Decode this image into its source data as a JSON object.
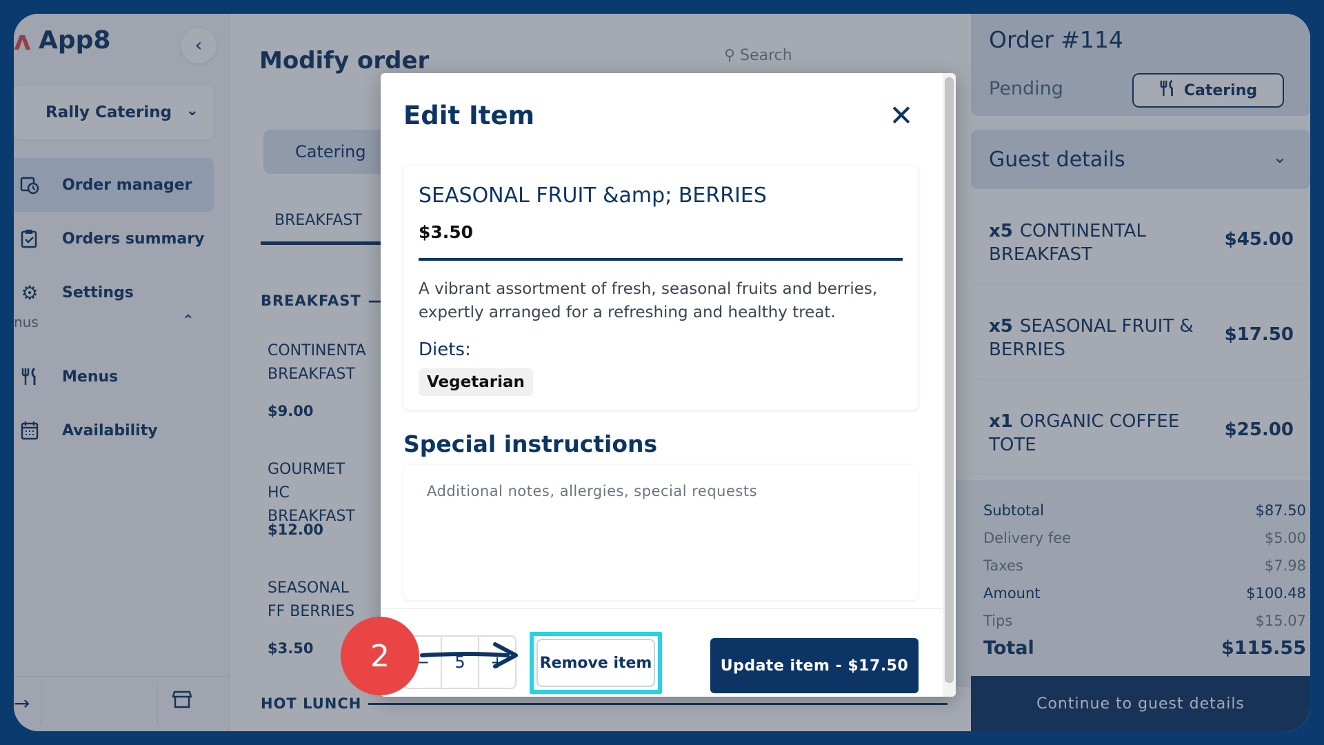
{
  "sidebar": {
    "app_name": "App8",
    "venue": "Rally Catering",
    "nav": [
      {
        "label": "Order manager",
        "icon": "calendar-clock-icon",
        "active": true
      },
      {
        "label": "Orders summary",
        "icon": "clipboard-check-icon"
      },
      {
        "label": "Settings",
        "icon": "gear-icon"
      },
      {
        "label": "Menus",
        "icon": "utensils-icon"
      },
      {
        "label": "Availability",
        "icon": "calendar-icon"
      }
    ],
    "section_menus": "nus"
  },
  "main": {
    "title": "Modify order",
    "search_placeholder": "Search",
    "category_tab": "Catering",
    "subcategory": "BREAKFAST",
    "section_breakfast": "BREAKFAST",
    "section_hot_lunch": "HOT LUNCH",
    "items": [
      {
        "name": "CONTINENTA BREAKFAST",
        "price": "$9.00"
      },
      {
        "name": "GOURMET HC BREAKFAST",
        "price": "$12.00"
      },
      {
        "name": "SEASONAL FF BERRIES",
        "price": "$3.50"
      }
    ]
  },
  "order": {
    "title": "Order #114",
    "status": "Pending",
    "type_label": "Catering",
    "guest_details": "Guest details",
    "line_items": [
      {
        "qty": "x5",
        "name": "CONTINENTAL BREAKFAST",
        "price": "$45.00"
      },
      {
        "qty": "x5",
        "name": "SEASONAL FRUIT & BERRIES",
        "price": "$17.50"
      },
      {
        "qty": "x1",
        "name": "ORGANIC COFFEE TOTE",
        "price": "$25.00"
      }
    ],
    "totals": {
      "subtotal_label": "Subtotal",
      "subtotal": "$87.50",
      "delivery_label": "Delivery fee",
      "delivery": "$5.00",
      "taxes_label": "Taxes",
      "taxes": "$7.98",
      "amount_label": "Amount",
      "amount": "$100.48",
      "tips_label": "Tips",
      "tips": "$15.07",
      "total_label": "Total",
      "total": "$115.55"
    },
    "continue_label": "Continue to guest details"
  },
  "modal": {
    "title": "Edit Item",
    "item_name": "SEASONAL FRUIT &amp; BERRIES",
    "item_price": "$3.50",
    "description": "A vibrant assortment of fresh, seasonal fruits and berries, expertly arranged for a refreshing and healthy treat.",
    "diets_label": "Diets:",
    "diet": "Vegetarian",
    "special_title": "Special instructions",
    "special_placeholder": "Additional notes, allergies, special requests",
    "quantity": "5",
    "remove_label": "Remove item",
    "update_label": "Update item - $17.50"
  },
  "annotation": {
    "step": "2",
    "highlight_color": "#24d4e4",
    "marker_color": "#ea4545"
  },
  "colors": {
    "brand": "#0c3566",
    "frame": "#0a3a6e"
  }
}
